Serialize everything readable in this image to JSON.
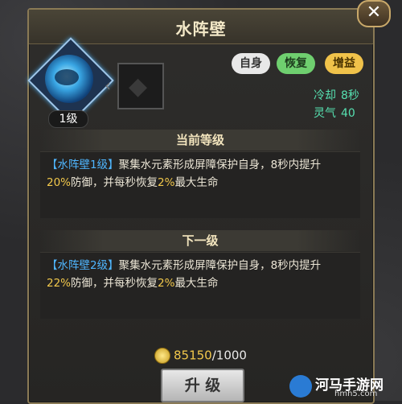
{
  "title": "水阵壁",
  "close_glyph": "✕",
  "skill": {
    "icon": "water-shield-icon",
    "level_label": "1级",
    "next_icon": "locked-skill-icon",
    "arrow": "‹"
  },
  "tags": [
    "自身",
    "恢复",
    "增益"
  ],
  "stats": {
    "cooldown_label": "冷却",
    "cooldown_value": "8秒",
    "spirit_label": "灵气",
    "spirit_value": "40"
  },
  "current": {
    "header": "当前等级",
    "name": "【水阵壁1级】",
    "text_a": "聚集水元素形成屏障保护自身，8秒内提升",
    "pct1": "20%",
    "text_b": "防御，并每秒恢复",
    "pct2": "2%",
    "text_c": "最大生命"
  },
  "next": {
    "header": "下一级",
    "name": "【水阵壁2级】",
    "text_a": "聚集水元素形成屏障保护自身，8秒内提升",
    "pct1": "22%",
    "text_b": "防御，并每秒恢复",
    "pct2": "2%",
    "text_c": "最大生命"
  },
  "cost": {
    "icon": "coin-icon",
    "have": "85150",
    "need": "/1000"
  },
  "upgrade_label": "升 级",
  "watermark": {
    "text": "河马手游网",
    "sub": "hmh5.com"
  },
  "colors": {
    "name_blue": "#4fb6ff",
    "highlight_yellow": "#f2c84b",
    "stat_green": "#56e0b0"
  }
}
